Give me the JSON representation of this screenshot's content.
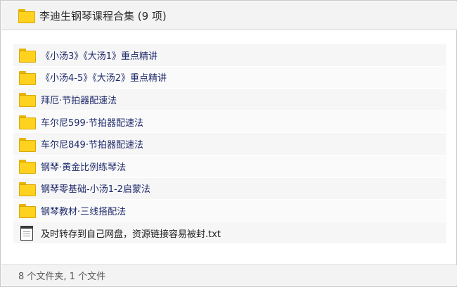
{
  "header": {
    "title": "李迪生钢琴课程合集 (9 项)"
  },
  "items": [
    {
      "label": "《小汤3》《大汤1》重点精讲",
      "type": "folder"
    },
    {
      "label": "《小汤4-5》《大汤2》重点精讲",
      "type": "folder"
    },
    {
      "label": "拜厄·节拍器配速法",
      "type": "folder"
    },
    {
      "label": "车尔尼599·节拍器配速法",
      "type": "folder"
    },
    {
      "label": "车尔尼849·节拍器配速法",
      "type": "folder"
    },
    {
      "label": "钢琴·黄金比例练琴法",
      "type": "folder"
    },
    {
      "label": "钢琴零基础-小汤1-2启蒙法",
      "type": "folder"
    },
    {
      "label": "钢琴教材·三线搭配法",
      "type": "folder"
    },
    {
      "label": "及时转存到自己网盘，资源链接容易被封.txt",
      "type": "file"
    }
  ],
  "footer": {
    "summary": "8 个文件夹, 1 个文件"
  },
  "icons": {
    "folder": "folder-icon",
    "file": "text-file-icon"
  },
  "colors": {
    "folder_fill": "#ffd21f",
    "folder_label": "#1f2a6b",
    "bar_bg": "#f3f3f3"
  }
}
